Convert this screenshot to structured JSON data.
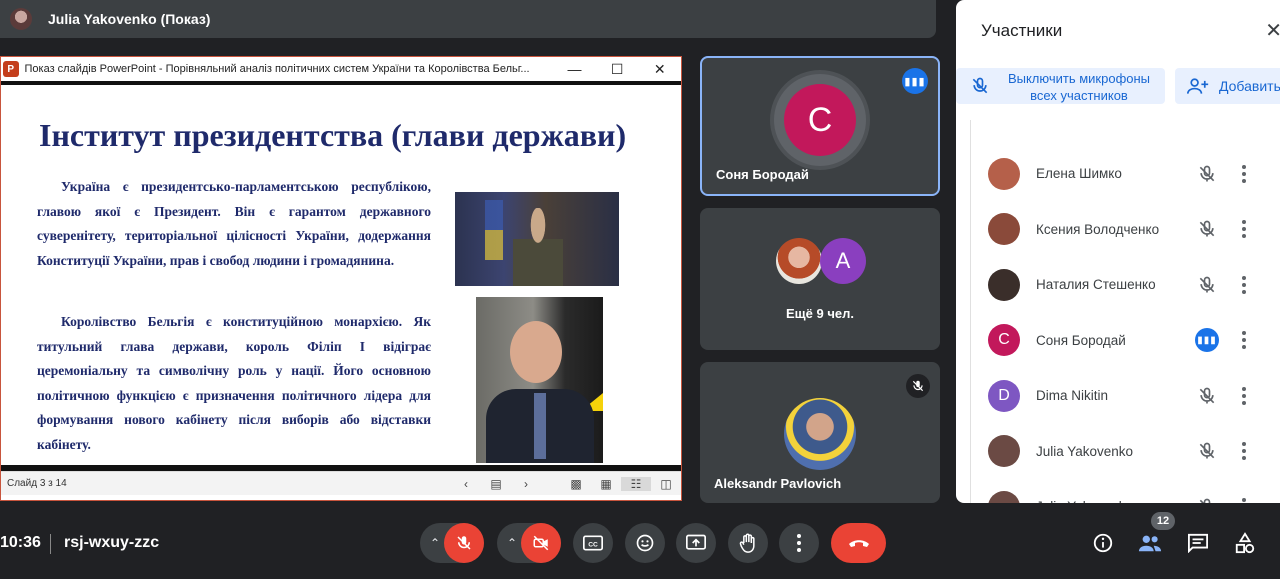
{
  "presenter": {
    "name": "Julia Yakovenko (Показ)"
  },
  "ppt": {
    "window_title": "Показ слайдів PowerPoint  -  Порівняльний аналіз політичних систем України та Королівства Бельг...",
    "status": "Слайд 3 з 14",
    "slide": {
      "title": "Інститут президентства (глави держави)",
      "paragraph1": "Україна є президентсько-парламентською республікою, главою якої є Президент. Він є гарантом державного суверенітету, територіальної цілісності України, додержання Конституції України, прав і свобод людини і громадянина.",
      "paragraph2": "Королівство Бельгія є конституційною монархією. Як титульний глава держави, король Філіп I відіграє церемоніальну та символічну роль у нації. Його основною політичною функцією є призначення політичного лідера для формування нового кабінету після виборів або відставки кабінету."
    }
  },
  "tiles": [
    {
      "name": "Соня Бородай",
      "initial": "C",
      "color": "#c2185b"
    },
    {
      "more": "Ещё 9 чел.",
      "initial": "A"
    },
    {
      "name": "Aleksandr Pavlovich"
    }
  ],
  "panel": {
    "title": "Участники",
    "mute_all": "Выключить микрофоны всех участников",
    "add": "Добавить",
    "participants": [
      {
        "name": "Елена Шимко",
        "initial": "",
        "color": "#b5604a",
        "speaking": false
      },
      {
        "name": "Ксения Володченко",
        "initial": "",
        "color": "#8a4a3a",
        "speaking": false
      },
      {
        "name": "Наталия Стешенко",
        "initial": "",
        "color": "#3a2e2a",
        "speaking": false
      },
      {
        "name": "Соня Бородай",
        "initial": "C",
        "color": "#c2185b",
        "speaking": true
      },
      {
        "name": "Dima Nikitin",
        "initial": "D",
        "color": "#7e57c2",
        "speaking": false
      },
      {
        "name": "Julia Yakovenko",
        "initial": "",
        "color": "#6b4a44",
        "speaking": false
      },
      {
        "name": "Julia Yakovenko",
        "initial": "",
        "color": "#6b4a44",
        "speaking": false
      }
    ]
  },
  "meeting": {
    "time": "10:36",
    "code": "rsj-wxuy-zzc",
    "participant_count": "12"
  },
  "colors": {
    "hangup": "#ea4335",
    "accent": "#1a73e8",
    "panel_bg": "#ffffff",
    "bg": "#202124"
  }
}
